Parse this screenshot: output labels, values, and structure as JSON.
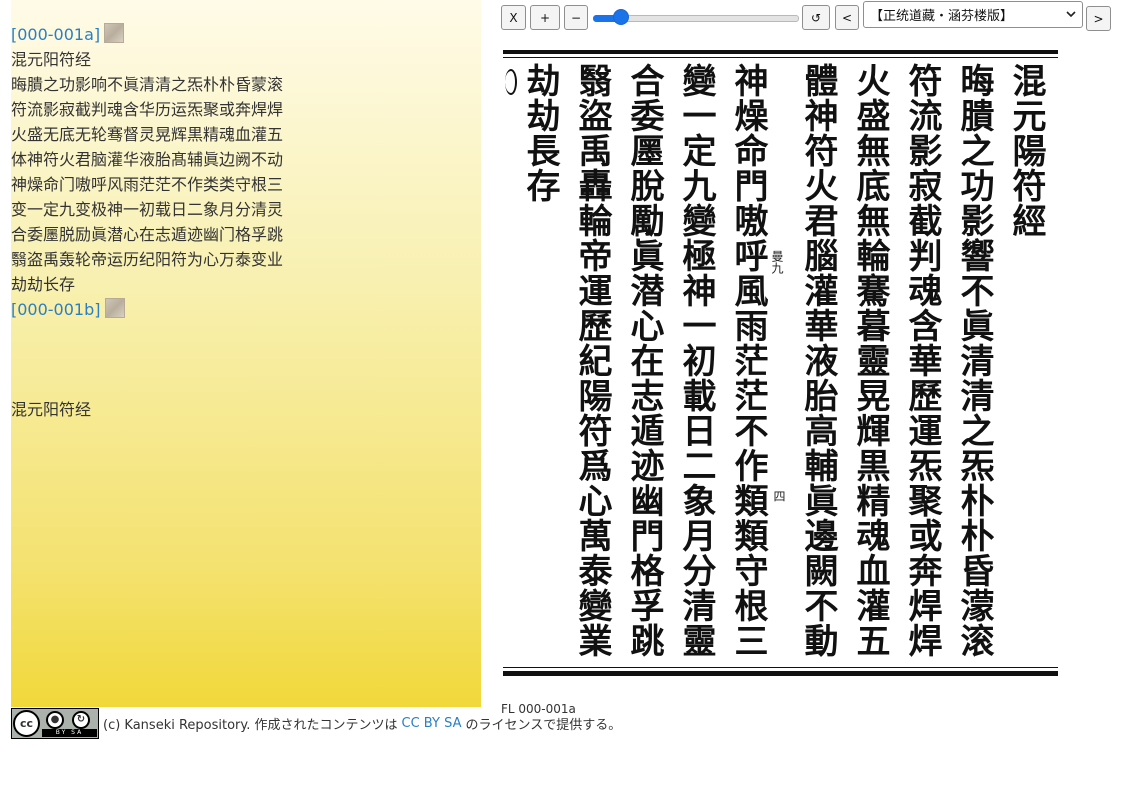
{
  "text_panel": {
    "page_link_a": "[000-001a]",
    "title": "混元阳符经",
    "lines": [
      "晦膭之功影响不眞清清之炁朴朴昏蒙滚",
      "符流影寂截判魂含华历运炁聚或奔焊焊",
      "火盛无底无轮骞督灵晃辉黒精魂血灌五",
      "体神符火君脑灌华液胎髙辅眞边阙不动",
      "神燥命门嗷呼风雨茫茫不作类类守根三",
      "变一定九变极神一初载日二象月分清灵",
      "合委㕓脱励眞潜心在志遁迹幽门格孚跳",
      "翳盗禹轰轮帝运历纪阳符为心万泰变业",
      "劫劫长存"
    ],
    "page_link_b": "[000-001b]",
    "bottom_title": "混元阳符经"
  },
  "toolbar": {
    "close_label": "X",
    "zoom_in_label": "+",
    "zoom_out_label": "−",
    "zoom_fraction": 0.1,
    "reset_label": "↺",
    "prev_label": "<",
    "edition_selected": "【正统道藏・涵芬楼版】",
    "next_label": ">"
  },
  "scan": {
    "columns": [
      "混元陽符經",
      "晦膭之功影響不眞清清之炁朴朴昏濛滚",
      "符流影寂截判魂含華歷運炁聚或奔焊焊",
      "火盛無底無輪騫暮靈晃輝黒精魂血灌五",
      "體神符火君腦灌華液胎高輔眞邊闕不動",
      "神燥命門嗷呼風雨茫茫不作類類守根三",
      "變一定九變極神一初載日二象月分清靈",
      "合委㕓脫勵眞潜心在志遁迹幽門格孚跳",
      "翳盜禹轟輪帝運歷紀陽符爲心萬泰變業",
      "劫劫長存"
    ],
    "note_top": "曼九",
    "note_mid": "四"
  },
  "image_caption": "FL 000-001a",
  "footer": {
    "cc_label": "cc",
    "cc_bar": "BY SA",
    "text_before": "(c) Kanseki Repository. 作成されたコンテンツは",
    "license_link": "CC BY SA",
    "text_after": "のライセンスで提供する。"
  }
}
